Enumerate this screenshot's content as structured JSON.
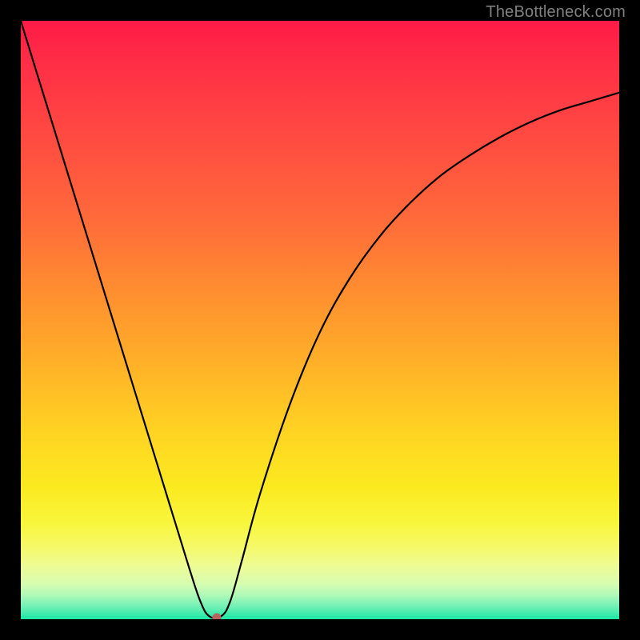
{
  "watermark": "TheBottleneck.com",
  "chart_data": {
    "type": "line",
    "title": "",
    "xlabel": "",
    "ylabel": "",
    "xlim": [
      0,
      100
    ],
    "ylim": [
      0,
      100
    ],
    "grid": false,
    "legend": false,
    "series": [
      {
        "name": "curve",
        "x": [
          0,
          4,
          8,
          12,
          16,
          20,
          24,
          28,
          30,
          31.5,
          33.5,
          35,
          37,
          40,
          45,
          50,
          55,
          60,
          65,
          70,
          75,
          80,
          85,
          90,
          95,
          100
        ],
        "y": [
          100,
          87,
          74,
          61,
          48,
          35,
          22,
          9,
          3,
          0.5,
          0.5,
          3,
          10,
          21,
          36,
          48,
          57,
          64,
          69.5,
          74,
          77.5,
          80.5,
          83,
          85,
          86.5,
          88
        ]
      }
    ],
    "minimum_marker": {
      "x": 32.8,
      "y": 0.3,
      "color": "#bb615e"
    },
    "background_gradient": {
      "stops": [
        {
          "pos": 0.0,
          "color": "#ff1a46"
        },
        {
          "pos": 0.18,
          "color": "#ff4742"
        },
        {
          "pos": 0.45,
          "color": "#ff8d30"
        },
        {
          "pos": 0.69,
          "color": "#ffd422"
        },
        {
          "pos": 0.88,
          "color": "#f5f96a"
        },
        {
          "pos": 1.0,
          "color": "#19e6a6"
        }
      ]
    }
  }
}
